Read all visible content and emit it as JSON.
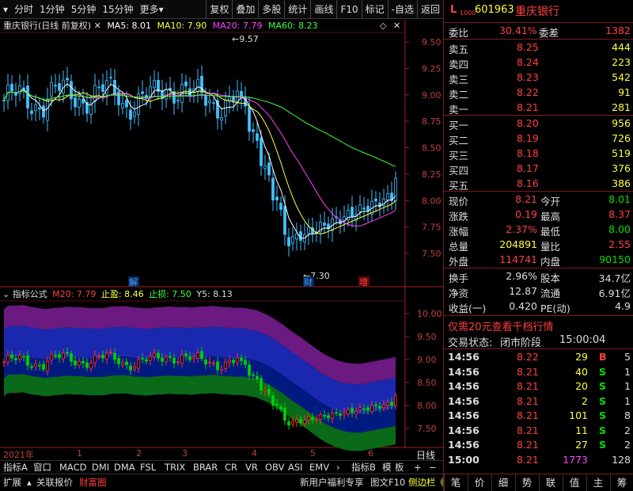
{
  "toolbar": {
    "items": [
      "分时",
      "1分钟",
      "5分钟",
      "15分钟",
      "更多"
    ],
    "right_items": [
      "复权",
      "叠加",
      "多股",
      "统计",
      "画线",
      "F10",
      "标记",
      "-自选",
      "返回"
    ]
  },
  "main_chart": {
    "title": "重庆银行(日线 前复权)",
    "ma5": "MA5: 8.01",
    "ma10": "MA10: 7.90",
    "ma20": "MA20: 7.79",
    "ma60": "MA60: 8.23",
    "high_label": "9.57",
    "low_label": "7.30",
    "y_ticks": [
      "9.50",
      "9.25",
      "9.00",
      "8.75",
      "8.50",
      "8.25",
      "8.00",
      "7.75",
      "7.50"
    ],
    "markers": [
      "解",
      "财",
      "增"
    ]
  },
  "indicator_chart": {
    "title": "指标公式",
    "m20": "M20: 7.79",
    "stop_profit": "止盈: 8.46",
    "stop_loss": "止损: 7.50",
    "y5": "Y5: 8.13",
    "y_ticks": [
      "10.00",
      "9.50",
      "9.00",
      "8.50",
      "8.00",
      "7.50"
    ]
  },
  "x_axis": {
    "year_label": "2021年",
    "months": [
      "1",
      "2",
      "3",
      "4",
      "5",
      "6"
    ],
    "period": "日线"
  },
  "bottom_tabs": {
    "row1": [
      "指标A",
      "窗口",
      "MACD",
      "DMI",
      "DMA",
      "FSL",
      "TRIX",
      "BRAR",
      "CR",
      "VR",
      "OBV",
      "ASI",
      "EMV"
    ],
    "row1_right": [
      "指标B",
      "模",
      "板"
    ],
    "row2": [
      "扩展",
      "关联报价",
      "财富圈"
    ],
    "promo": "新用户福利专享",
    "row2_right": [
      "图文F10",
      "侧边栏"
    ]
  },
  "quote": {
    "code": "601963",
    "name": "重庆银行",
    "wb_label": "委比",
    "wb": "30.41%",
    "wc_label": "委差",
    "wc": "1382",
    "asks": [
      {
        "label": "卖五",
        "price": "8.25",
        "vol": "444"
      },
      {
        "label": "卖四",
        "price": "8.24",
        "vol": "223"
      },
      {
        "label": "卖三",
        "price": "8.23",
        "vol": "542"
      },
      {
        "label": "卖二",
        "price": "8.22",
        "vol": "91"
      },
      {
        "label": "卖一",
        "price": "8.21",
        "vol": "281"
      }
    ],
    "bids": [
      {
        "label": "买一",
        "price": "8.20",
        "vol": "956"
      },
      {
        "label": "买二",
        "price": "8.19",
        "vol": "726"
      },
      {
        "label": "买三",
        "price": "8.18",
        "vol": "519"
      },
      {
        "label": "买四",
        "price": "8.17",
        "vol": "376"
      },
      {
        "label": "买五",
        "price": "8.16",
        "vol": "386"
      }
    ],
    "stats": [
      {
        "l1": "现价",
        "v1": "8.21",
        "c1": "#ff4040",
        "l2": "今开",
        "v2": "8.01",
        "c2": "#00e000"
      },
      {
        "l1": "涨跌",
        "v1": "0.19",
        "c1": "#ff4040",
        "l2": "最高",
        "v2": "8.37",
        "c2": "#ff4040"
      },
      {
        "l1": "涨幅",
        "v1": "2.37%",
        "c1": "#ff4040",
        "l2": "最低",
        "v2": "8.00",
        "c2": "#00e000"
      },
      {
        "l1": "总量",
        "v1": "204891",
        "c1": "#ffff40",
        "l2": "量比",
        "v2": "2.55",
        "c2": "#ff4040"
      },
      {
        "l1": "外盘",
        "v1": "114741",
        "c1": "#ff4040",
        "l2": "内盘",
        "v2": "90150",
        "c2": "#00e000"
      }
    ],
    "stats2": [
      {
        "l1": "换手",
        "v1": "2.96%",
        "l2": "股本",
        "v2": "34.7亿"
      },
      {
        "l1": "净资",
        "v1": "12.87",
        "l2": "流通",
        "v2": "6.91亿"
      },
      {
        "l1": "收益(一)",
        "v1": "0.420",
        "l2": "PE(动)",
        "v2": "4.9"
      }
    ],
    "promo": "仅需20元查看千档行情",
    "status_label": "交易状态:",
    "status": "闭市阶段",
    "status_time": "15:00:04",
    "ticks": [
      {
        "t": "14:56",
        "p": "8.22",
        "v": "29",
        "s": "B",
        "n": "5"
      },
      {
        "t": "14:56",
        "p": "8.21",
        "v": "40",
        "s": "S",
        "n": "1"
      },
      {
        "t": "14:56",
        "p": "8.21",
        "v": "20",
        "s": "S",
        "n": "1"
      },
      {
        "t": "14:56",
        "p": "8.21",
        "v": "2",
        "s": "S",
        "n": "1"
      },
      {
        "t": "14:56",
        "p": "8.21",
        "v": "101",
        "s": "S",
        "n": "8"
      },
      {
        "t": "14:56",
        "p": "8.21",
        "v": "11",
        "s": "S",
        "n": "2"
      },
      {
        "t": "14:56",
        "p": "8.21",
        "v": "27",
        "s": "S",
        "n": "2"
      },
      {
        "t": "15:00",
        "p": "8.21",
        "v": "1773",
        "s": "",
        "n": "128"
      }
    ],
    "bottom_tabs": [
      "笔",
      "价",
      "细",
      "势",
      "联",
      "值",
      "主",
      "筹"
    ]
  }
}
